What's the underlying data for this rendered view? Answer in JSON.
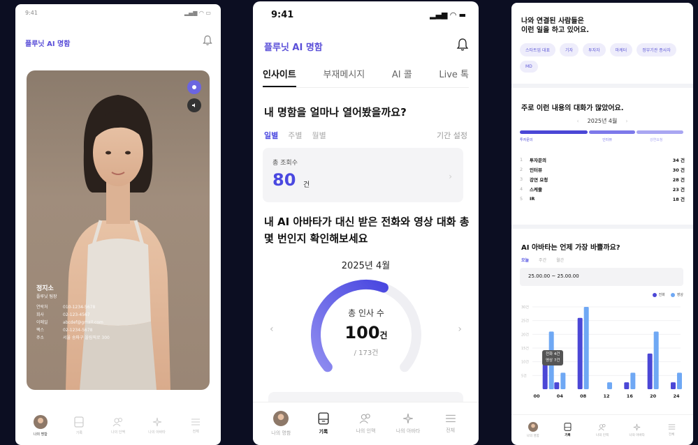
{
  "colors": {
    "accent": "#4a48e0",
    "accent_light": "#8f8cf0",
    "background": "#0c0e22",
    "call": "#4b47d6",
    "video": "#6fa8f4"
  },
  "screen1": {
    "status_time": "9:41",
    "app_title": "플루닛 AI 명함",
    "profile_name": "정지소",
    "profile_role": "플루닛 팀장",
    "info_rows": [
      {
        "label": "연락처",
        "value": "010-1234-5678"
      },
      {
        "label": "회사",
        "value": "02-123-4567"
      },
      {
        "label": "이메일",
        "value": "abcdef@gmail.com"
      },
      {
        "label": "팩스",
        "value": "02-1234-5678"
      },
      {
        "label": "주소",
        "value": "서울 송파구 올림픽로 300"
      }
    ],
    "tabbar": [
      {
        "label": "나의 명함",
        "icon": "avatar"
      },
      {
        "label": "기록",
        "icon": "document-icon"
      },
      {
        "label": "나의 인맥",
        "icon": "people-icon"
      },
      {
        "label": "나의 아바타",
        "icon": "sparkle-icon"
      },
      {
        "label": "전체",
        "icon": "menu-icon"
      }
    ]
  },
  "screen2": {
    "status_time": "9:41",
    "app_title": "플루닛 AI 명함",
    "tabs": [
      "인사이트",
      "부재메시지",
      "AI 콜",
      "Live 톡"
    ],
    "active_tab": 0,
    "heading1": "내 명함을 얼마나 열어봤을까요?",
    "period_tabs": [
      "일별",
      "주별",
      "월별"
    ],
    "period_active": 0,
    "period_setting": "기간 설정",
    "views_card": {
      "label": "총 조회수",
      "value": "80",
      "unit": "건"
    },
    "heading2": "내 AI 아바타가 대신 받은 전화와 영상 대화 총 몇 번인지 확인해보세요",
    "month": "2025년 4월",
    "gauge": {
      "label": "총 인사 수",
      "value": "100",
      "unit": "건",
      "total": "/ 173건",
      "fraction": 0.578
    },
    "tabbar": [
      {
        "label": "나의 명함",
        "icon": "avatar"
      },
      {
        "label": "기록",
        "icon": "document-icon"
      },
      {
        "label": "나의 인맥",
        "icon": "people-icon"
      },
      {
        "label": "나의 아바타",
        "icon": "sparkle-icon"
      },
      {
        "label": "전체",
        "icon": "menu-icon"
      }
    ],
    "active_tabbar": 1
  },
  "screen3": {
    "section1_title_line1": "나와 연결된 사람들은",
    "section1_title_line2": "이런 일을 하고 있어요.",
    "chips": [
      "스타트업 대표",
      "기자",
      "투자자",
      "마케터",
      "정부기관 종사자",
      "MD"
    ],
    "section2_title": "주로 이런 내용의 대화가 많았어요.",
    "month": "2025년 4월",
    "progress_labels": [
      "투자문의",
      "인터뷰",
      "강연요청"
    ],
    "progress_fractions": [
      0.42,
      0.29,
      0.29
    ],
    "topics": [
      {
        "rank": "1",
        "name": "투자문의",
        "count": "34 건"
      },
      {
        "rank": "2",
        "name": "인터뷰",
        "count": "30 건"
      },
      {
        "rank": "3",
        "name": "강연 요청",
        "count": "28 건"
      },
      {
        "rank": "4",
        "name": "스케줄",
        "count": "23 건"
      },
      {
        "rank": "5",
        "name": "IR",
        "count": "18 건"
      }
    ],
    "section3_title": "AI 아바타는 언제 가장 바쁠까요?",
    "period_tabs": [
      "오늘",
      "주간",
      "월간"
    ],
    "period_active": 0,
    "date_range": "25.00.00 ~ 25.00.00",
    "legend": [
      "전화",
      "영상"
    ],
    "tooltip_line1": "전화 4건",
    "tooltip_line2": "영상 7건",
    "tabbar": [
      {
        "label": "나의 명함",
        "icon": "avatar"
      },
      {
        "label": "기록",
        "icon": "document-icon"
      },
      {
        "label": "나의 인맥",
        "icon": "people-icon"
      },
      {
        "label": "나의 아바타",
        "icon": "sparkle-icon"
      },
      {
        "label": "전체",
        "icon": "menu-icon"
      }
    ],
    "active_tabbar": 1
  },
  "chart_data": {
    "type": "bar",
    "title": "AI 아바타는 언제 가장 바쁠까요?",
    "xlabel": "",
    "ylabel": "",
    "x_ticks": [
      "00",
      "04",
      "08",
      "12",
      "16",
      "20",
      "24"
    ],
    "y_ticks": [
      "5건",
      "10건",
      "15건",
      "20건",
      "25건",
      "30건"
    ],
    "ylim": [
      0,
      30
    ],
    "grid": true,
    "legend": "top-right",
    "groups": [
      {
        "x": 2,
        "values": [
          13,
          21
        ]
      },
      {
        "x": 4,
        "values": [
          2.5,
          6
        ]
      },
      {
        "x": 8,
        "values": [
          26,
          30
        ]
      },
      {
        "x": 12,
        "values": [
          0,
          2.5
        ]
      },
      {
        "x": 16,
        "values": [
          2.5,
          6
        ]
      },
      {
        "x": 20,
        "values": [
          13,
          21
        ]
      },
      {
        "x": 24,
        "values": [
          2.5,
          6
        ]
      }
    ],
    "series": [
      {
        "name": "전화",
        "color": "#4b47d6"
      },
      {
        "name": "영상",
        "color": "#6fa8f4"
      }
    ]
  }
}
